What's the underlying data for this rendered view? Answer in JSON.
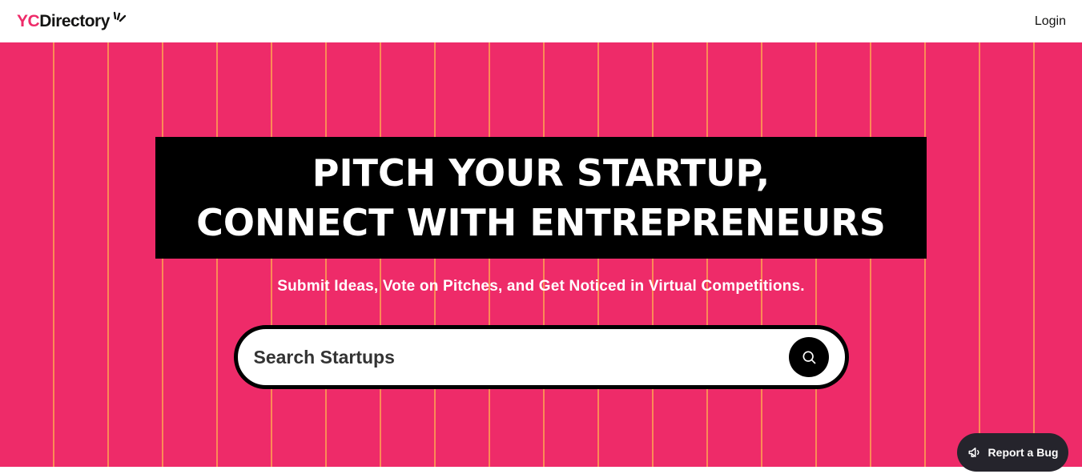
{
  "navbar": {
    "logo_prefix": "YC",
    "logo_suffix": "Directory",
    "login_label": "Login"
  },
  "hero": {
    "heading_line1": "Pitch Your Startup,",
    "heading_line2": "Connect With Entrepreneurs",
    "subheading": "Submit Ideas, Vote on Pitches, and Get Noticed in Virtual Competitions."
  },
  "search": {
    "placeholder": "Search Startups",
    "value": "",
    "button_icon": "search-icon"
  },
  "report_bug": {
    "label": "Report a Bug",
    "icon": "megaphone-icon"
  },
  "colors": {
    "brand_pink": "#EE2B69",
    "stripe": "#FFAA50",
    "black": "#000000",
    "bug_button_bg": "#25242C"
  }
}
